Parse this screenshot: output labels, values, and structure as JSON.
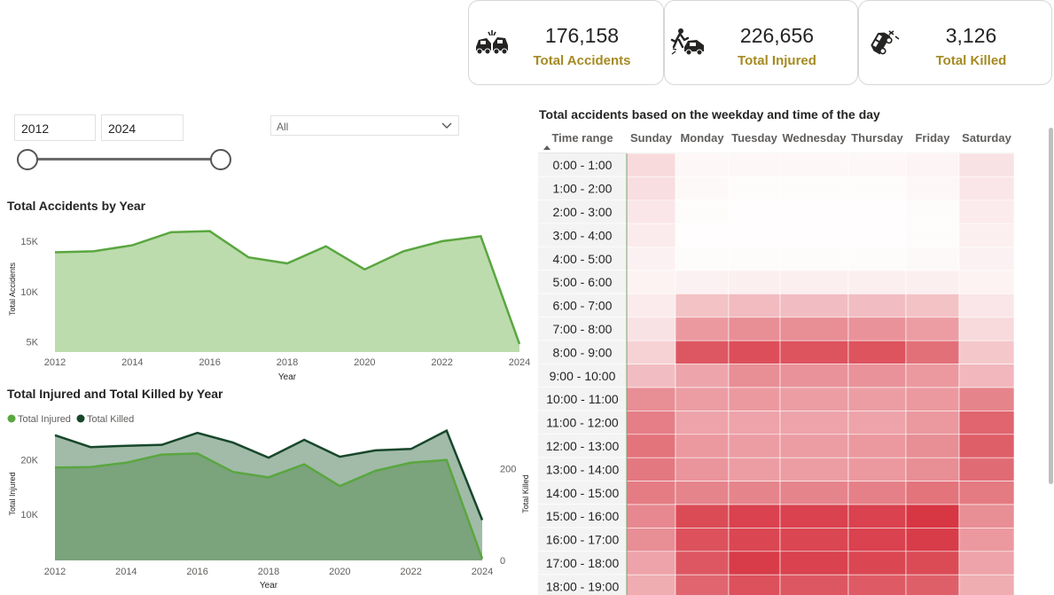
{
  "kpis": [
    {
      "value": "176,158",
      "label": "Total Accidents",
      "icon": "car-crash-icon"
    },
    {
      "value": "226,656",
      "label": "Total Injured",
      "icon": "pedestrian-hit-icon"
    },
    {
      "value": "3,126",
      "label": "Total Killed",
      "icon": "overturned-car-icon"
    }
  ],
  "filters": {
    "year_start": "2012",
    "year_end": "2024",
    "dropdown_value": "All"
  },
  "colors": {
    "accent_gold": "#a58a22",
    "area_light": "#bcdcad",
    "line_green": "#5aa640",
    "injured_fill": "#7ba37c",
    "killed_fill": "#a1bba8",
    "killed_line": "#17472b",
    "heat_max": "#d6323f"
  },
  "chart_data": [
    {
      "type": "area",
      "title": "Total Accidents by Year",
      "xlabel": "Year",
      "ylabel": "Total Accidents",
      "x": [
        2012,
        2013,
        2014,
        2015,
        2016,
        2017,
        2018,
        2019,
        2020,
        2021,
        2022,
        2023,
        2024
      ],
      "x_ticks": [
        "2012",
        "2014",
        "2016",
        "2018",
        "2020",
        "2022",
        "2024"
      ],
      "y_ticks": [
        "15K",
        "10K",
        "5K"
      ],
      "ylim": [
        4000,
        16500
      ],
      "values": [
        13900,
        14000,
        14600,
        15900,
        16000,
        13400,
        12800,
        14500,
        12200,
        14000,
        15000,
        15500,
        4800
      ],
      "legend": "none",
      "grid": false
    },
    {
      "type": "area",
      "title": "Total Injured and Total Killed by Year",
      "xlabel": "Year",
      "ylabel": "Total Injured",
      "y2label": "Total Killed",
      "x": [
        2012,
        2013,
        2014,
        2015,
        2016,
        2017,
        2018,
        2019,
        2020,
        2021,
        2022,
        2023,
        2024
      ],
      "x_ticks": [
        "2012",
        "2014",
        "2016",
        "2018",
        "2020",
        "2022",
        "2024"
      ],
      "y_ticks": [
        "20K",
        "10K"
      ],
      "y2_ticks": [
        "200",
        "0"
      ],
      "ylim": [
        1500,
        26000
      ],
      "y2lim": [
        0,
        290
      ],
      "legend": "top-left",
      "series": [
        {
          "name": "Total Injured",
          "axis": "left",
          "values": [
            18600,
            18700,
            19500,
            21000,
            21200,
            17800,
            16800,
            19200,
            15200,
            18000,
            19500,
            20000,
            1800
          ]
        },
        {
          "name": "Total Killed",
          "axis": "right",
          "values": [
            273,
            247,
            250,
            252,
            278,
            257,
            224,
            263,
            226,
            240,
            243,
            283,
            88
          ]
        }
      ]
    },
    {
      "type": "heatmap",
      "title": "Total accidents based on the weekday and time of the day",
      "corner_label": "Time range",
      "columns": [
        "Sunday",
        "Monday",
        "Tuesday",
        "Wednesday",
        "Thursday",
        "Friday",
        "Saturday"
      ],
      "rows": [
        "0:00 - 1:00",
        "1:00 - 2:00",
        "2:00 - 3:00",
        "3:00 - 4:00",
        "4:00 - 5:00",
        "5:00 - 6:00",
        "6:00 - 7:00",
        "7:00 - 8:00",
        "8:00 - 9:00",
        "9:00 - 10:00",
        "10:00 - 11:00",
        "11:00 - 12:00",
        "12:00 - 13:00",
        "13:00 - 14:00",
        "14:00 - 15:00",
        "15:00 - 16:00",
        "16:00 - 17:00",
        "17:00 - 18:00",
        "18:00 - 19:00"
      ],
      "intensity": [
        [
          0.18,
          0.04,
          0.04,
          0.04,
          0.04,
          0.05,
          0.14
        ],
        [
          0.16,
          0.03,
          0.02,
          0.02,
          0.02,
          0.04,
          0.12
        ],
        [
          0.12,
          0.02,
          0.01,
          0.01,
          0.01,
          0.02,
          0.1
        ],
        [
          0.1,
          0.01,
          0.01,
          0.01,
          0.01,
          0.02,
          0.08
        ],
        [
          0.07,
          0.02,
          0.02,
          0.02,
          0.02,
          0.03,
          0.07
        ],
        [
          0.06,
          0.07,
          0.08,
          0.08,
          0.08,
          0.08,
          0.06
        ],
        [
          0.1,
          0.3,
          0.33,
          0.32,
          0.32,
          0.3,
          0.12
        ],
        [
          0.14,
          0.5,
          0.55,
          0.55,
          0.53,
          0.48,
          0.18
        ],
        [
          0.22,
          0.82,
          0.86,
          0.84,
          0.84,
          0.7,
          0.27
        ],
        [
          0.32,
          0.44,
          0.55,
          0.53,
          0.53,
          0.5,
          0.35
        ],
        [
          0.55,
          0.48,
          0.5,
          0.48,
          0.48,
          0.5,
          0.6
        ],
        [
          0.63,
          0.45,
          0.45,
          0.45,
          0.45,
          0.5,
          0.75
        ],
        [
          0.68,
          0.5,
          0.48,
          0.48,
          0.5,
          0.55,
          0.78
        ],
        [
          0.66,
          0.52,
          0.48,
          0.48,
          0.5,
          0.55,
          0.72
        ],
        [
          0.64,
          0.6,
          0.6,
          0.6,
          0.62,
          0.68,
          0.65
        ],
        [
          0.58,
          0.88,
          0.92,
          0.92,
          0.92,
          0.98,
          0.55
        ],
        [
          0.55,
          0.85,
          0.9,
          0.9,
          0.92,
          0.95,
          0.5
        ],
        [
          0.45,
          0.82,
          0.95,
          0.92,
          0.9,
          0.88,
          0.45
        ],
        [
          0.4,
          0.75,
          0.85,
          0.82,
          0.8,
          0.78,
          0.4
        ]
      ]
    }
  ]
}
